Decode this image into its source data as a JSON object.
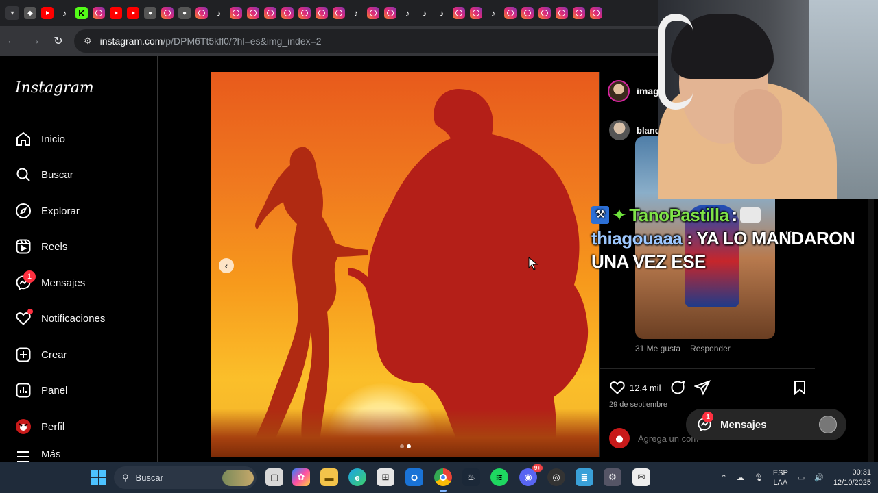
{
  "browser": {
    "tabs": [
      "youtube",
      "tiktok",
      "kick",
      "instagram",
      "youtube",
      "youtube",
      "other",
      "instagram",
      "other",
      "instagram",
      "tiktok",
      "instagram",
      "instagram",
      "instagram",
      "instagram",
      "instagram",
      "instagram",
      "instagram",
      "tiktok",
      "instagram",
      "instagram",
      "tiktok",
      "tiktok",
      "tiktok",
      "instagram",
      "instagram",
      "tiktok",
      "instagram",
      "instagram",
      "instagram",
      "instagram",
      "instagram",
      "instagram"
    ],
    "url_host": "instagram.com",
    "url_rest": "/p/DPM6Tt5kfl0/?hl=es&img_index=2"
  },
  "sidebar": {
    "logo": "Instagram",
    "items": [
      {
        "label": "Inicio",
        "icon": "home-icon"
      },
      {
        "label": "Buscar",
        "icon": "search-icon"
      },
      {
        "label": "Explorar",
        "icon": "compass-icon"
      },
      {
        "label": "Reels",
        "icon": "reels-icon"
      },
      {
        "label": "Mensajes",
        "icon": "messenger-icon",
        "badge": "1"
      },
      {
        "label": "Notificaciones",
        "icon": "heart-icon"
      },
      {
        "label": "Crear",
        "icon": "plus-icon"
      },
      {
        "label": "Panel",
        "icon": "chart-icon"
      },
      {
        "label": "Perfil",
        "icon": "avatar-icon"
      },
      {
        "label": "Más",
        "icon": "menu-icon"
      }
    ]
  },
  "post": {
    "author": "imag",
    "carousel_index": 2,
    "carousel_total": 2,
    "comment_user": "blanq",
    "comment_likes": "31 Me gusta",
    "reply_label": "Responder",
    "likes": "12,4 mil",
    "date": "29 de septiembre",
    "comment_placeholder": "Agrega un com"
  },
  "chat": {
    "line1_user": "TanoPastilla",
    "line1_sep": " :",
    "line2_user": "thiagouaaa",
    "line2_msg": " : YA LO MANDARON",
    "line3_msg": "UNA VEZ ESE"
  },
  "floating_messages": {
    "label": "Mensajes",
    "badge": "1"
  },
  "taskbar": {
    "search_label": "Buscar",
    "lang_top": "ESP",
    "lang_bottom": "LAA",
    "time": "00:31",
    "date": "12/10/2025",
    "discord_badge": "9+"
  },
  "colors": {
    "instagram_red": "#ff3040",
    "chat_green": "#7fe348",
    "chat_blue": "#9dc8ff"
  }
}
